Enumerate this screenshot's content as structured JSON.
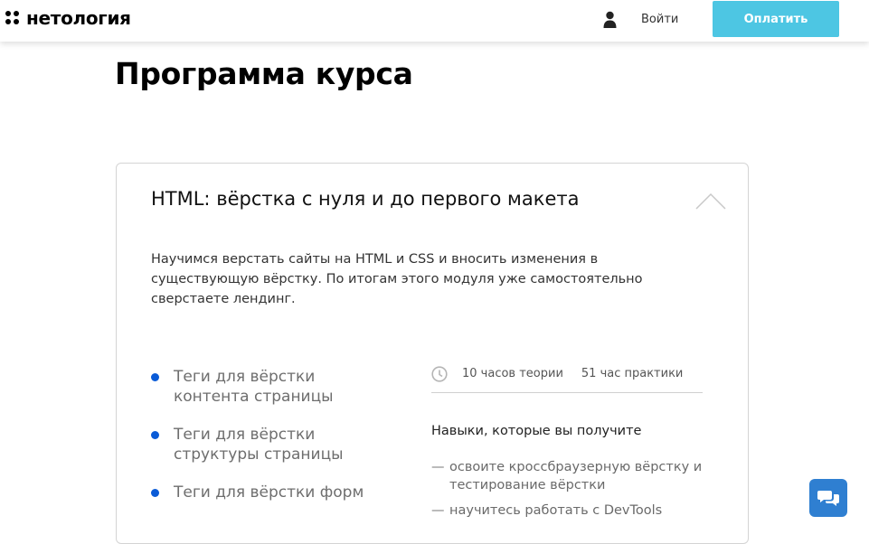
{
  "header": {
    "logo_text": "нетология",
    "login_label": "Войти",
    "pay_label": "Оплатить",
    "accent_color": "#4dc6e3"
  },
  "main": {
    "page_title": "Программа курса",
    "module": {
      "title": "HTML: вёрстка с нуля и до первого макета",
      "description": "Научимся верстать сайты на HTML и CSS и вносить изменения в существующую вёрстку. По итогам этого модуля уже самостоятельно сверстаете лендинг.",
      "expanded": true,
      "topics": [
        "Теги для вёрстки контента страницы",
        "Теги для вёрстки структуры страницы",
        "Теги для вёрстки форм"
      ],
      "theory_hours": "10 часов теории",
      "practice_hours": "51 час практики",
      "skills_title": "Навыки, которые вы получите",
      "skills": [
        "освоите кроссбраузерную вёрстку и тестирование вёрстки",
        "научитесь работать с DevTools"
      ],
      "bullet_color": "#0a5bd7"
    }
  },
  "chat_widget": {
    "icon": "chat-bubbles-icon",
    "color": "#2f7fd1"
  }
}
